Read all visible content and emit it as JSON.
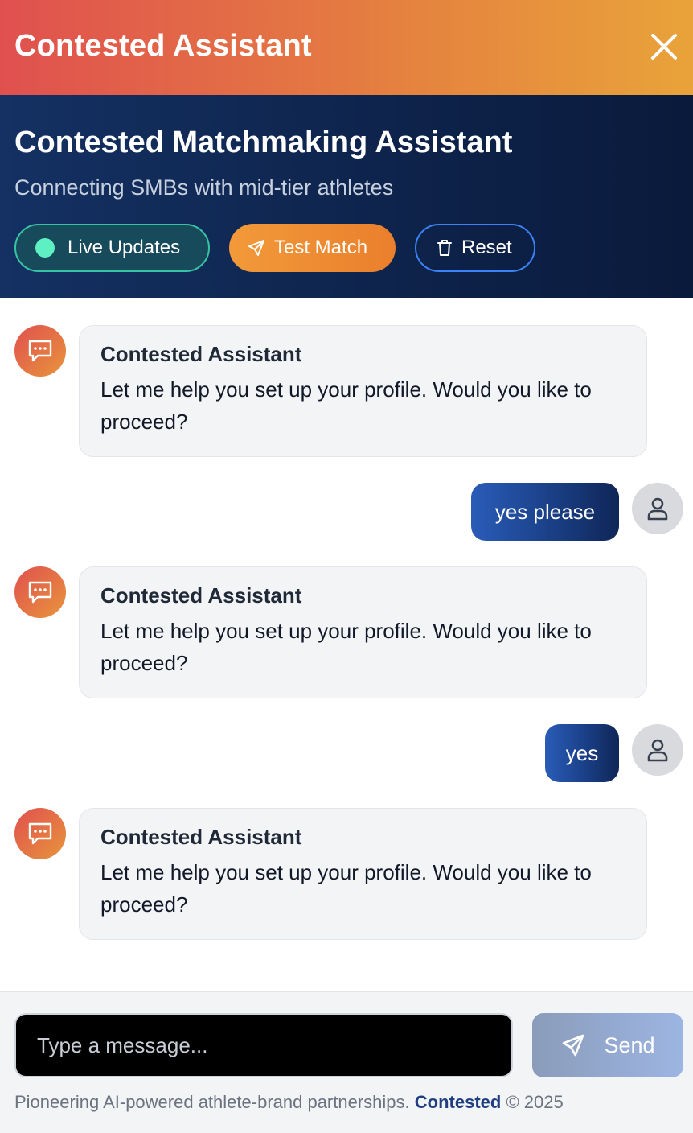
{
  "topbar": {
    "title": "Contested Assistant"
  },
  "hero": {
    "title": "Contested Matchmaking Assistant",
    "subtitle": "Connecting SMBs with mid-tier athletes",
    "buttons": {
      "live": "Live Updates",
      "test": "Test Match",
      "reset": "Reset"
    }
  },
  "messages": [
    {
      "role": "assistant",
      "name": "Contested Assistant",
      "text": "Let me help you set up your profile. Would you like to proceed?"
    },
    {
      "role": "user",
      "text": "yes please"
    },
    {
      "role": "assistant",
      "name": "Contested Assistant",
      "text": "Let me help you set up your profile. Would you like to proceed?"
    },
    {
      "role": "user",
      "text": "yes"
    },
    {
      "role": "assistant",
      "name": "Contested Assistant",
      "text": "Let me help you set up your profile. Would you like to proceed?"
    }
  ],
  "composer": {
    "placeholder": "Type a message...",
    "value": "",
    "send_label": "Send"
  },
  "footer": {
    "text": "Pioneering AI-powered athlete-brand partnerships.",
    "brand": "Contested",
    "copyright": "© 2025"
  },
  "colors": {
    "accent_orange": "#e8953c",
    "accent_red": "#e0504f",
    "navy": "#0f2650",
    "live_green": "#5ef0c3"
  }
}
